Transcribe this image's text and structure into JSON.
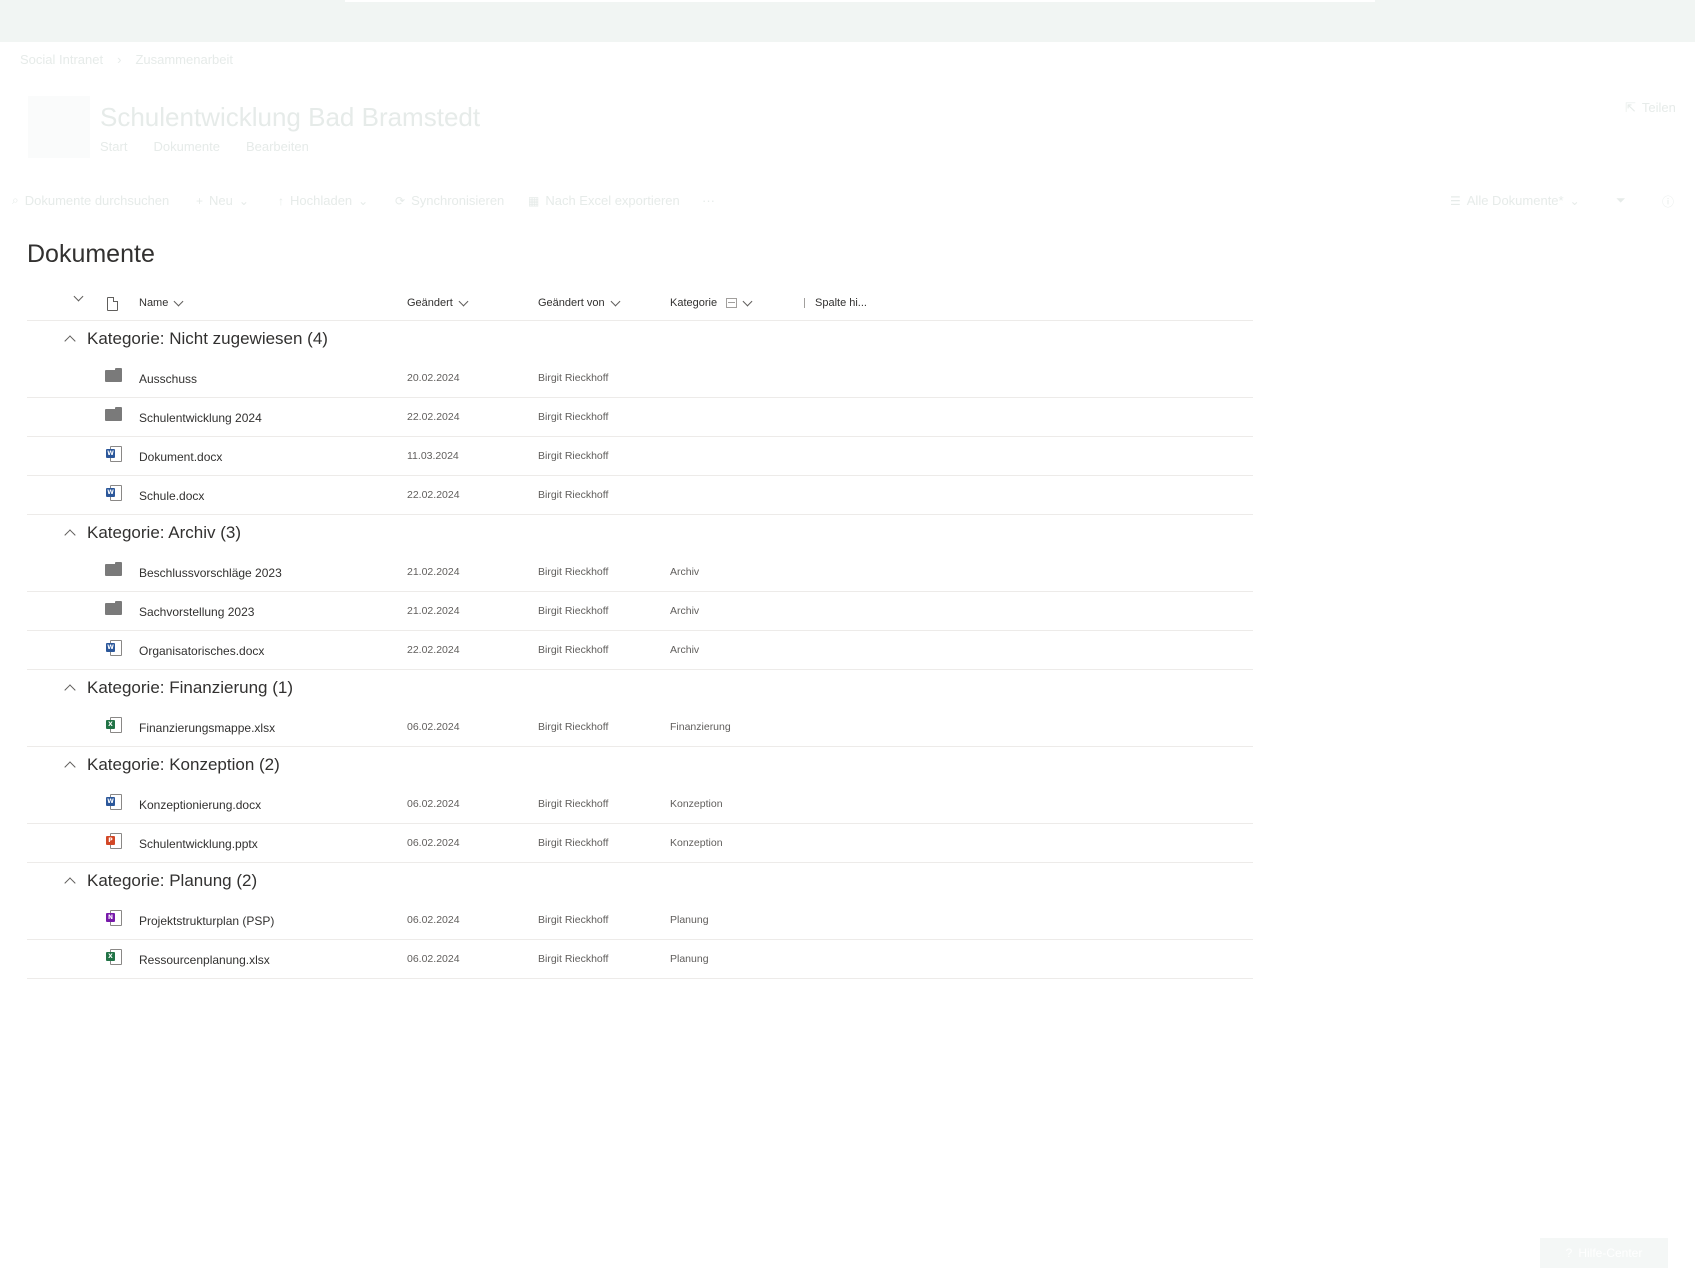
{
  "colors": {
    "word": "#2b579a",
    "excel": "#217346",
    "powerpoint": "#d24726",
    "onenote": "#7719aa",
    "folder": "#7a7a7a"
  },
  "breadcrumb": [
    "Social Intranet",
    "Zusammenarbeit"
  ],
  "site": {
    "title": "Schulentwicklung Bad Bramstedt",
    "nav": [
      "Start",
      "Dokumente",
      "Bearbeiten"
    ],
    "share_label": "Teilen"
  },
  "commandbar": {
    "search_placeholder": "Dokumente durchsuchen",
    "new_label": "Neu",
    "upload_label": "Hochladen",
    "sync_label": "Synchronisieren",
    "export_label": "Nach Excel exportieren",
    "more_label": "···",
    "view_label": "Alle Dokumente*"
  },
  "library": {
    "title": "Dokumente",
    "columns": {
      "name": "Name",
      "modified": "Geändert",
      "modified_by": "Geändert von",
      "category": "Kategorie",
      "add_column": "Spalte hi..."
    },
    "groups": [
      {
        "label": "Kategorie: Nicht zugewiesen (4)",
        "items": [
          {
            "type": "folder",
            "name": "Ausschuss",
            "modified": "20.02.2024",
            "modified_by": "Birgit Rieckhoff",
            "category": ""
          },
          {
            "type": "folder",
            "name": "Schulentwicklung 2024",
            "modified": "22.02.2024",
            "modified_by": "Birgit Rieckhoff",
            "category": ""
          },
          {
            "type": "word",
            "name": "Dokument.docx",
            "modified": "11.03.2024",
            "modified_by": "Birgit Rieckhoff",
            "category": ""
          },
          {
            "type": "word",
            "name": "Schule.docx",
            "modified": "22.02.2024",
            "modified_by": "Birgit Rieckhoff",
            "category": ""
          }
        ]
      },
      {
        "label": "Kategorie: Archiv (3)",
        "items": [
          {
            "type": "folder",
            "name": "Beschlussvorschläge 2023",
            "modified": "21.02.2024",
            "modified_by": "Birgit Rieckhoff",
            "category": "Archiv"
          },
          {
            "type": "folder",
            "name": "Sachvorstellung 2023",
            "modified": "21.02.2024",
            "modified_by": "Birgit Rieckhoff",
            "category": "Archiv"
          },
          {
            "type": "word",
            "name": "Organisatorisches.docx",
            "modified": "22.02.2024",
            "modified_by": "Birgit Rieckhoff",
            "category": "Archiv"
          }
        ]
      },
      {
        "label": "Kategorie: Finanzierung (1)",
        "items": [
          {
            "type": "excel",
            "name": "Finanzierungsmappe.xlsx",
            "modified": "06.02.2024",
            "modified_by": "Birgit Rieckhoff",
            "category": "Finanzierung"
          }
        ]
      },
      {
        "label": "Kategorie: Konzeption (2)",
        "items": [
          {
            "type": "word",
            "name": "Konzeptionierung.docx",
            "modified": "06.02.2024",
            "modified_by": "Birgit Rieckhoff",
            "category": "Konzeption"
          },
          {
            "type": "powerpoint",
            "name": "Schulentwicklung.pptx",
            "modified": "06.02.2024",
            "modified_by": "Birgit Rieckhoff",
            "category": "Konzeption"
          }
        ]
      },
      {
        "label": "Kategorie: Planung (2)",
        "items": [
          {
            "type": "onenote",
            "name": "Projektstrukturplan (PSP)",
            "modified": "06.02.2024",
            "modified_by": "Birgit Rieckhoff",
            "category": "Planung"
          },
          {
            "type": "excel",
            "name": "Ressourcenplanung.xlsx",
            "modified": "06.02.2024",
            "modified_by": "Birgit Rieckhoff",
            "category": "Planung"
          }
        ]
      }
    ]
  },
  "help_label": "Hilfe-Center"
}
